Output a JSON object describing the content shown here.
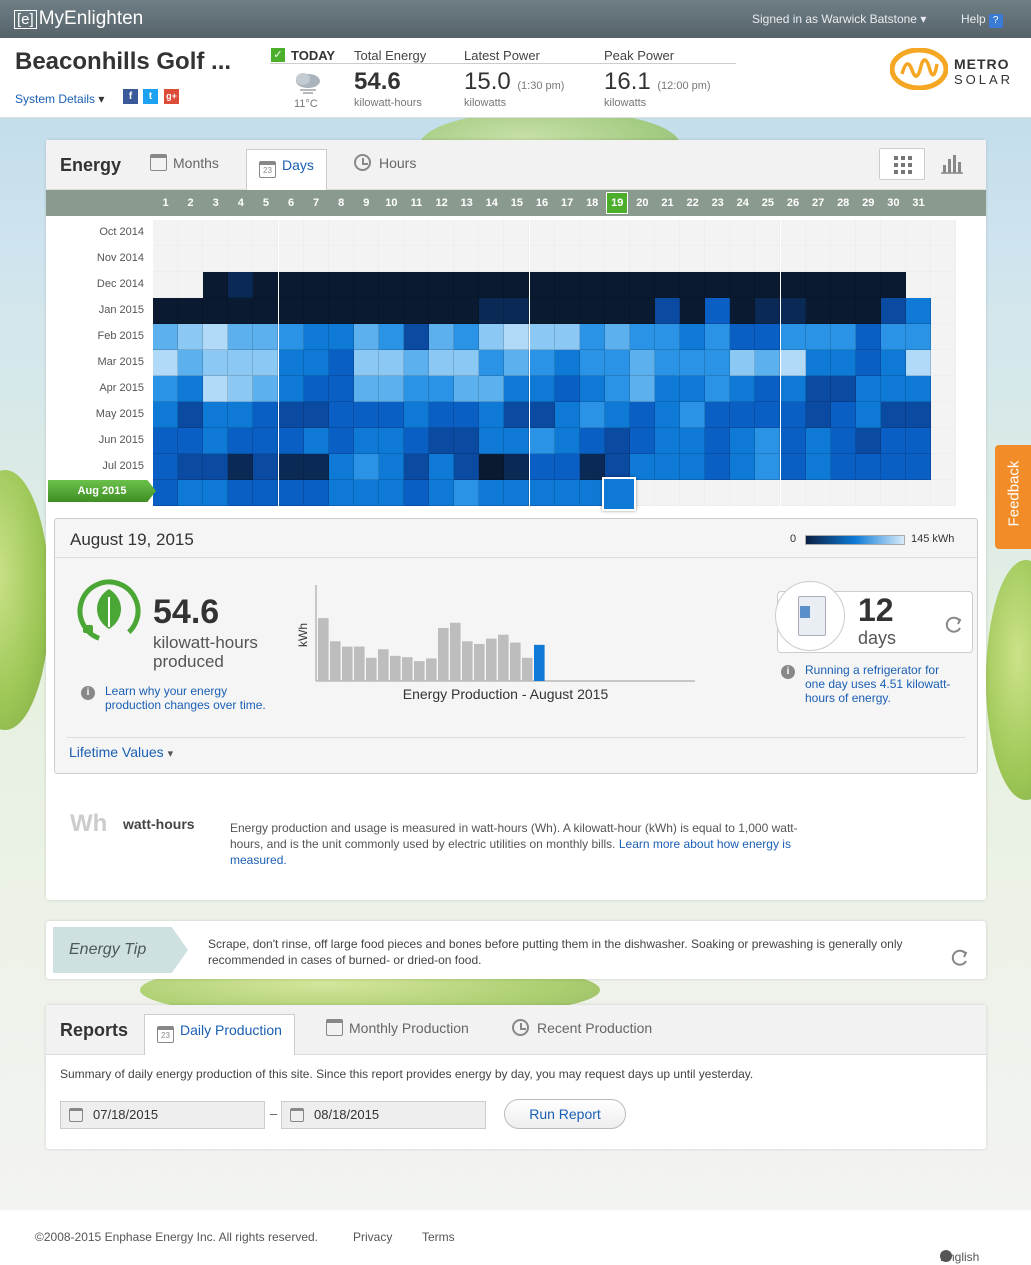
{
  "topbar": {
    "logo_bracket": "[e]",
    "logo_text": "MyEnlighten",
    "signed_in": "Signed in as Warwick Batstone",
    "help": "Help",
    "help_icon": "?"
  },
  "header": {
    "site_name": "Beaconhills Golf ...",
    "system_details": "System Details",
    "social": [
      "f",
      "t",
      "g+"
    ],
    "today_label": "TODAY",
    "weather_temp": "11°C",
    "total_energy": {
      "label": "Total Energy",
      "value": "54.6",
      "unit": "kilowatt-hours"
    },
    "latest_power": {
      "label": "Latest Power",
      "value": "15.0",
      "time": "(1:30 pm)",
      "unit": "kilowatts"
    },
    "peak_power": {
      "label": "Peak Power",
      "value": "16.1",
      "time": "(12:00 pm)",
      "unit": "kilowatts"
    },
    "brand_line1": "METRO",
    "brand_line2": "SOLAR"
  },
  "energy": {
    "title": "Energy",
    "tabs": [
      "Months",
      "Days",
      "Hours"
    ],
    "active_tab": "Days",
    "cal_icon_num": "23",
    "days": [
      "1",
      "2",
      "3",
      "4",
      "5",
      "6",
      "7",
      "8",
      "9",
      "10",
      "11",
      "12",
      "13",
      "14",
      "15",
      "16",
      "17",
      "18",
      "19",
      "20",
      "21",
      "22",
      "23",
      "24",
      "25",
      "26",
      "27",
      "28",
      "29",
      "30",
      "31"
    ],
    "selected_day": "19",
    "months": [
      "Oct 2014",
      "Nov 2014",
      "Dec 2014",
      "Jan 2015",
      "Feb 2015",
      "Mar 2015",
      "Apr 2015",
      "May 2015",
      "Jun 2015",
      "Jul 2015",
      "Aug 2015"
    ],
    "selected_month": "Aug 2015",
    "palette": [
      "#0a1a30",
      "#0a2a55",
      "#0a4aa0",
      "#0a5fc4",
      "#0e7ad6",
      "#2a93e6",
      "#5cb0ee",
      "#8cc8f4",
      "#b0daf8"
    ],
    "heat_rows": [
      "",
      "",
      "..0100000000000000000000000000",
      "000000000000011000002030110002450",
      "67866544652657877565545335553558",
      "86777443776775654556555768443487",
      "54876433665566443456445434224444",
      "4244322333433422454345333323422",
      "3343334344322445432344345343233",
      "3221211454242013312444345343333",
      "344333344434544444"
    ]
  },
  "detail": {
    "date": "August 19, 2015",
    "legend_min": "0",
    "legend_max": "145 kWh",
    "produced_value": "54.6",
    "produced_unit": "kilowatt-hours",
    "produced_label": "produced",
    "learn_link": "Learn why your energy production changes over time.",
    "chart_ylabel": "kWh",
    "chart_title": "Energy Production - August 2015",
    "equiv_value": "12",
    "equiv_unit": "days",
    "equiv_text": "Running a refrigerator for one day uses 4.51 kilowatt-hours of energy.",
    "lifetime": "Lifetime Values",
    "wh_abbr": "Wh",
    "wh_term": "watt-hours",
    "wh_text": "Energy production and usage is measured in watt-hours (Wh). A kilowatt-hour (kWh) is equal to 1,000 watt-hours, and is the unit commonly used by electric utilities on monthly bills.",
    "wh_link": "Learn more about how energy is measured."
  },
  "chart_data": {
    "type": "bar",
    "title": "Energy Production - August 2015",
    "xlabel": "",
    "ylabel": "kWh",
    "categories": [
      "1",
      "2",
      "3",
      "4",
      "5",
      "6",
      "7",
      "8",
      "9",
      "10",
      "11",
      "12",
      "13",
      "14",
      "15",
      "16",
      "17",
      "18",
      "19"
    ],
    "values": [
      95,
      60,
      52,
      52,
      35,
      48,
      38,
      36,
      30,
      34,
      80,
      88,
      60,
      56,
      64,
      70,
      58,
      35,
      54.6
    ],
    "highlight": "19",
    "ylim": [
      0,
      145
    ]
  },
  "tip": {
    "label": "Energy Tip",
    "text": "Scrape, don't rinse, off large food pieces and bones before putting them in the dishwasher. Soaking or prewashing is generally only recommended in cases of burned- or dried-on food."
  },
  "reports": {
    "title": "Reports",
    "tabs": [
      "Daily Production",
      "Monthly Production",
      "Recent Production"
    ],
    "summary": "Summary of daily energy production of this site. Since this report provides energy by day, you may request days up until yesterday.",
    "start_date": "07/18/2015",
    "end_date": "08/18/2015",
    "dash": "–",
    "run": "Run Report"
  },
  "feedback": "Feedback",
  "footer": {
    "copyright": "©2008-2015 Enphase Energy Inc. All rights reserved.",
    "privacy": "Privacy",
    "terms": "Terms",
    "language": "English"
  }
}
